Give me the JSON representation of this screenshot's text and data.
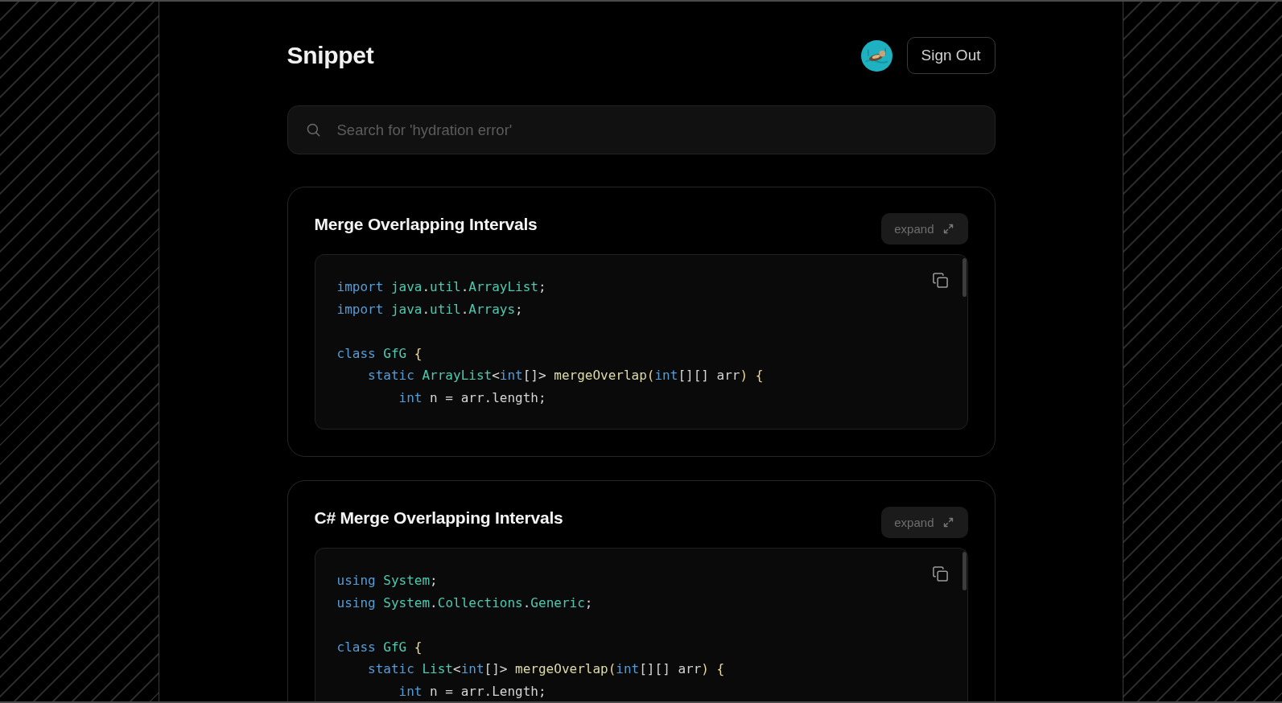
{
  "header": {
    "title": "Snippet",
    "sign_out_label": "Sign Out"
  },
  "search": {
    "placeholder": "Search for 'hydration error'"
  },
  "snippets": [
    {
      "title": "Merge Overlapping Intervals",
      "expand_label": "expand",
      "lines": [
        {
          "kind": "code",
          "tokens": [
            {
              "text": "import",
              "kind": "keyword"
            },
            {
              "text": " java",
              "kind": "type"
            },
            {
              "text": ".",
              "kind": "plain"
            },
            {
              "text": "util",
              "kind": "type"
            },
            {
              "text": ".",
              "kind": "plain"
            },
            {
              "text": "ArrayList",
              "kind": "type"
            },
            {
              "text": ";",
              "kind": "plain"
            }
          ]
        },
        {
          "kind": "code",
          "tokens": [
            {
              "text": "import",
              "kind": "keyword"
            },
            {
              "text": " java",
              "kind": "type"
            },
            {
              "text": ".",
              "kind": "plain"
            },
            {
              "text": "util",
              "kind": "type"
            },
            {
              "text": ".",
              "kind": "plain"
            },
            {
              "text": "Arrays",
              "kind": "type"
            },
            {
              "text": ";",
              "kind": "plain"
            }
          ]
        },
        {
          "kind": "blank"
        },
        {
          "kind": "code",
          "tokens": [
            {
              "text": "class",
              "kind": "keyword"
            },
            {
              "text": " GfG",
              "kind": "type"
            },
            {
              "text": " {",
              "kind": "bracket"
            }
          ]
        },
        {
          "kind": "code",
          "tokens": [
            {
              "text": "    static",
              "kind": "keyword"
            },
            {
              "text": " ArrayList",
              "kind": "type"
            },
            {
              "text": "<",
              "kind": "plain"
            },
            {
              "text": "int",
              "kind": "keyword"
            },
            {
              "text": "[]>",
              "kind": "plain"
            },
            {
              "text": " mergeOverlap",
              "kind": "function"
            },
            {
              "text": "(",
              "kind": "bracket"
            },
            {
              "text": "int",
              "kind": "keyword"
            },
            {
              "text": "[][] arr",
              "kind": "plain"
            },
            {
              "text": ")",
              "kind": "bracket"
            },
            {
              "text": " {",
              "kind": "bracket"
            }
          ]
        },
        {
          "kind": "code",
          "tokens": [
            {
              "text": "        int",
              "kind": "keyword"
            },
            {
              "text": " n = arr.length;",
              "kind": "plain"
            }
          ]
        }
      ]
    },
    {
      "title": "C# Merge Overlapping Intervals",
      "expand_label": "expand",
      "lines": [
        {
          "kind": "code",
          "tokens": [
            {
              "text": "using",
              "kind": "keyword"
            },
            {
              "text": " System",
              "kind": "type"
            },
            {
              "text": ";",
              "kind": "plain"
            }
          ]
        },
        {
          "kind": "code",
          "tokens": [
            {
              "text": "using",
              "kind": "keyword"
            },
            {
              "text": " System",
              "kind": "type"
            },
            {
              "text": ".",
              "kind": "plain"
            },
            {
              "text": "Collections",
              "kind": "type"
            },
            {
              "text": ".",
              "kind": "plain"
            },
            {
              "text": "Generic",
              "kind": "type"
            },
            {
              "text": ";",
              "kind": "plain"
            }
          ]
        },
        {
          "kind": "blank"
        },
        {
          "kind": "code",
          "tokens": [
            {
              "text": "class",
              "kind": "keyword"
            },
            {
              "text": " GfG",
              "kind": "type"
            },
            {
              "text": " {",
              "kind": "bracket"
            }
          ]
        },
        {
          "kind": "code",
          "tokens": [
            {
              "text": "    static",
              "kind": "keyword"
            },
            {
              "text": " List",
              "kind": "type"
            },
            {
              "text": "<",
              "kind": "plain"
            },
            {
              "text": "int",
              "kind": "keyword"
            },
            {
              "text": "[]>",
              "kind": "plain"
            },
            {
              "text": " mergeOverlap",
              "kind": "function"
            },
            {
              "text": "(",
              "kind": "bracket"
            },
            {
              "text": "int",
              "kind": "keyword"
            },
            {
              "text": "[][] arr",
              "kind": "plain"
            },
            {
              "text": ")",
              "kind": "bracket"
            },
            {
              "text": " {",
              "kind": "bracket"
            }
          ]
        },
        {
          "kind": "code",
          "tokens": [
            {
              "text": "        int",
              "kind": "keyword"
            },
            {
              "text": " n = arr.Length;",
              "kind": "plain"
            }
          ]
        }
      ]
    }
  ]
}
